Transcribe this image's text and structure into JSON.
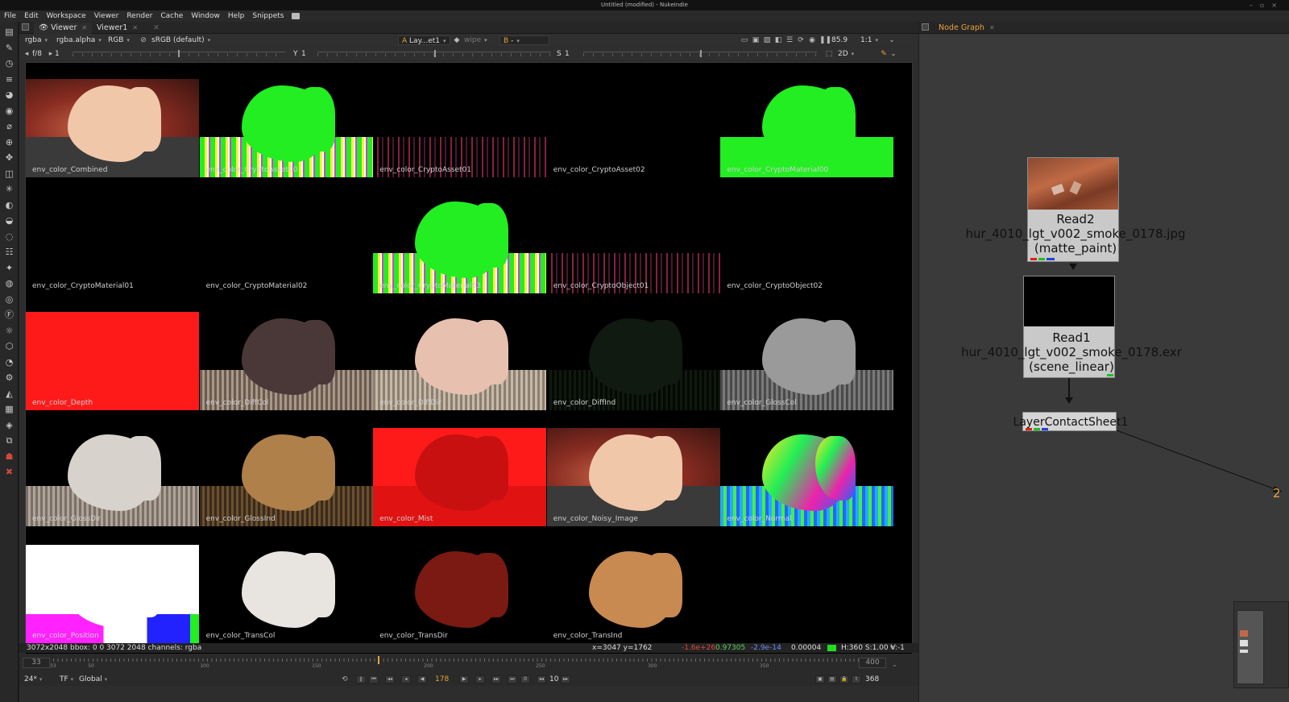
{
  "window": {
    "title": "Untitled (modified) - NukeIndie"
  },
  "menu": [
    "File",
    "Edit",
    "Workspace",
    "Viewer",
    "Render",
    "Cache",
    "Window",
    "Help",
    "Snippets"
  ],
  "viewer_tabs": [
    {
      "label": "Viewer"
    },
    {
      "label": "Viewer1"
    }
  ],
  "viewer_controls": {
    "layer": "rgba",
    "channel_alpha": "rgba.alpha",
    "display_channels": "RGB",
    "colorspace": "sRGB (default)",
    "input_a": "A",
    "input_a_value": "Lay...et1",
    "wipe": "wipe",
    "input_b": "B",
    "input_b_value": "-",
    "zoom_percent": "85.9",
    "ratio": "1:1",
    "gain_label": "f/8",
    "gain_value": "1",
    "gamma_label": "Y",
    "gamma_value": "1",
    "saturation_label": "S",
    "saturation_value": "1",
    "view_mode": "2D"
  },
  "contact_sheet": [
    {
      "label": "env_color_Combined",
      "type": "combined"
    },
    {
      "label": "env_color_CryptoAsset00",
      "type": "crypto_green"
    },
    {
      "label": "env_color_CryptoAsset01",
      "type": "crypto_dark"
    },
    {
      "label": "env_color_CryptoAsset02",
      "type": "black"
    },
    {
      "label": "env_color_CryptoMaterial00",
      "type": "crypto_green_soft"
    },
    {
      "label": "env_color_CryptoMaterial01",
      "type": "black"
    },
    {
      "label": "env_color_CryptoMaterial02",
      "type": "black"
    },
    {
      "label": "env_color_CryptoMaterial03",
      "type": "crypto_green"
    },
    {
      "label": "env_color_CryptoObject01",
      "type": "crypto_dark"
    },
    {
      "label": "env_color_CryptoObject02",
      "type": "black"
    },
    {
      "label": "env_color_Depth",
      "type": "red"
    },
    {
      "label": "env_color_DiffCol",
      "type": "diffcol"
    },
    {
      "label": "env_color_DiffDir",
      "type": "diffdir"
    },
    {
      "label": "env_color_DiffInd",
      "type": "dark"
    },
    {
      "label": "env_color_GlossCol",
      "type": "grey"
    },
    {
      "label": "env_color_GlossDir",
      "type": "glossdir"
    },
    {
      "label": "env_color_GlossInd",
      "type": "glossind"
    },
    {
      "label": "env_color_Mist",
      "type": "mist"
    },
    {
      "label": "env_color_Noisy_Image",
      "type": "combined"
    },
    {
      "label": "env_color_Normal",
      "type": "normal"
    },
    {
      "label": "env_color_Position",
      "type": "position"
    },
    {
      "label": "env_color_TransCol",
      "type": "transcol"
    },
    {
      "label": "env_color_TransDir",
      "type": "transdir"
    },
    {
      "label": "env_color_TransInd",
      "type": "transind"
    }
  ],
  "info_bar": {
    "format": "3072x2048  bbox: 0 0 3072 2048 channels: rgba",
    "coords": "x=3047 y=1762",
    "r": "-1.6e+26",
    "g": "0.97305",
    "b": "-2.9e-14",
    "a": "0.00004",
    "hsv": "H:360 S:1.00 V:-1"
  },
  "timeline": {
    "in_frame": "33",
    "out_frame": "400",
    "tick_labels": [
      "33",
      "50",
      "100",
      "150",
      "200",
      "250",
      "300",
      "350",
      "400"
    ],
    "current_frame": 178
  },
  "transport": {
    "fps": "24*",
    "tf": "TF",
    "scope": "Global",
    "current_frame": "178",
    "step": "10",
    "end_frame": "368"
  },
  "node_graph": {
    "tab_label": "Node Graph",
    "nodes": [
      {
        "name": "Read2",
        "file": "hur_4010_lgt_v002_smoke_0178.jpg",
        "colorspace": "(matte_paint)"
      },
      {
        "name": "Read1",
        "file": "hur_4010_lgt_v002_smoke_0178.exr",
        "colorspace": "(scene_linear)"
      },
      {
        "name": "LayerContactSheet1"
      }
    ],
    "pipe_label": "2"
  },
  "colors": {
    "accent": "#e8a33a",
    "crypto_green": "#22ee22",
    "red": "#ff1a1a",
    "node_body": "#c9c9c9"
  },
  "toolbar_icons": [
    "image-icon",
    "draw-icon",
    "time-icon",
    "channel-icon",
    "color-icon",
    "filter-icon",
    "keyer-icon",
    "merge-icon",
    "transform-icon",
    "3d-icon",
    "particles-icon",
    "deep-icon",
    "views-icon",
    "metadata-icon",
    "toolsets-icon",
    "other-icon",
    "furnace-icon",
    "cara-icon",
    "f-icon",
    "ocio-icon",
    "gizmo-icon",
    "bokeh-icon",
    "python-icon",
    "dirt-icon",
    "grain-icon",
    "mask-icon",
    "plug-icon",
    "user-icon",
    "eraser-icon"
  ]
}
